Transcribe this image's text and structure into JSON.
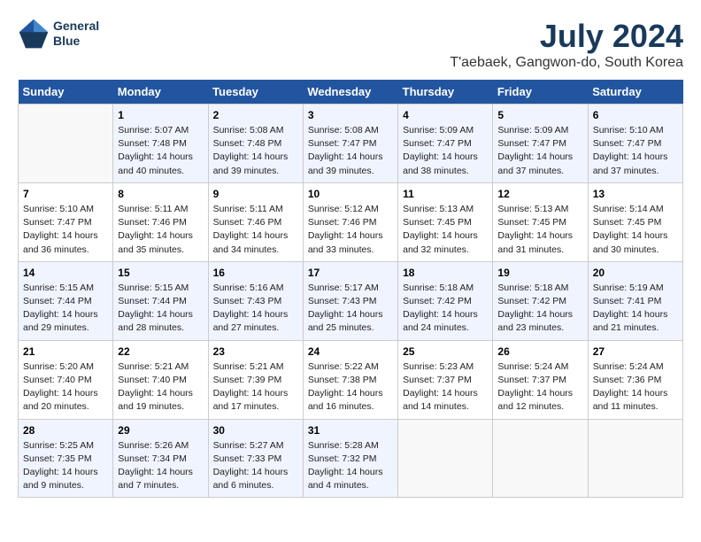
{
  "logo": {
    "line1": "General",
    "line2": "Blue"
  },
  "title": "July 2024",
  "subtitle": "T'aebaek, Gangwon-do, South Korea",
  "days_of_week": [
    "Sunday",
    "Monday",
    "Tuesday",
    "Wednesday",
    "Thursday",
    "Friday",
    "Saturday"
  ],
  "weeks": [
    [
      {
        "day": "",
        "info": ""
      },
      {
        "day": "1",
        "info": "Sunrise: 5:07 AM\nSunset: 7:48 PM\nDaylight: 14 hours\nand 40 minutes."
      },
      {
        "day": "2",
        "info": "Sunrise: 5:08 AM\nSunset: 7:48 PM\nDaylight: 14 hours\nand 39 minutes."
      },
      {
        "day": "3",
        "info": "Sunrise: 5:08 AM\nSunset: 7:47 PM\nDaylight: 14 hours\nand 39 minutes."
      },
      {
        "day": "4",
        "info": "Sunrise: 5:09 AM\nSunset: 7:47 PM\nDaylight: 14 hours\nand 38 minutes."
      },
      {
        "day": "5",
        "info": "Sunrise: 5:09 AM\nSunset: 7:47 PM\nDaylight: 14 hours\nand 37 minutes."
      },
      {
        "day": "6",
        "info": "Sunrise: 5:10 AM\nSunset: 7:47 PM\nDaylight: 14 hours\nand 37 minutes."
      }
    ],
    [
      {
        "day": "7",
        "info": "Sunrise: 5:10 AM\nSunset: 7:47 PM\nDaylight: 14 hours\nand 36 minutes."
      },
      {
        "day": "8",
        "info": "Sunrise: 5:11 AM\nSunset: 7:46 PM\nDaylight: 14 hours\nand 35 minutes."
      },
      {
        "day": "9",
        "info": "Sunrise: 5:11 AM\nSunset: 7:46 PM\nDaylight: 14 hours\nand 34 minutes."
      },
      {
        "day": "10",
        "info": "Sunrise: 5:12 AM\nSunset: 7:46 PM\nDaylight: 14 hours\nand 33 minutes."
      },
      {
        "day": "11",
        "info": "Sunrise: 5:13 AM\nSunset: 7:45 PM\nDaylight: 14 hours\nand 32 minutes."
      },
      {
        "day": "12",
        "info": "Sunrise: 5:13 AM\nSunset: 7:45 PM\nDaylight: 14 hours\nand 31 minutes."
      },
      {
        "day": "13",
        "info": "Sunrise: 5:14 AM\nSunset: 7:45 PM\nDaylight: 14 hours\nand 30 minutes."
      }
    ],
    [
      {
        "day": "14",
        "info": "Sunrise: 5:15 AM\nSunset: 7:44 PM\nDaylight: 14 hours\nand 29 minutes."
      },
      {
        "day": "15",
        "info": "Sunrise: 5:15 AM\nSunset: 7:44 PM\nDaylight: 14 hours\nand 28 minutes."
      },
      {
        "day": "16",
        "info": "Sunrise: 5:16 AM\nSunset: 7:43 PM\nDaylight: 14 hours\nand 27 minutes."
      },
      {
        "day": "17",
        "info": "Sunrise: 5:17 AM\nSunset: 7:43 PM\nDaylight: 14 hours\nand 25 minutes."
      },
      {
        "day": "18",
        "info": "Sunrise: 5:18 AM\nSunset: 7:42 PM\nDaylight: 14 hours\nand 24 minutes."
      },
      {
        "day": "19",
        "info": "Sunrise: 5:18 AM\nSunset: 7:42 PM\nDaylight: 14 hours\nand 23 minutes."
      },
      {
        "day": "20",
        "info": "Sunrise: 5:19 AM\nSunset: 7:41 PM\nDaylight: 14 hours\nand 21 minutes."
      }
    ],
    [
      {
        "day": "21",
        "info": "Sunrise: 5:20 AM\nSunset: 7:40 PM\nDaylight: 14 hours\nand 20 minutes."
      },
      {
        "day": "22",
        "info": "Sunrise: 5:21 AM\nSunset: 7:40 PM\nDaylight: 14 hours\nand 19 minutes."
      },
      {
        "day": "23",
        "info": "Sunrise: 5:21 AM\nSunset: 7:39 PM\nDaylight: 14 hours\nand 17 minutes."
      },
      {
        "day": "24",
        "info": "Sunrise: 5:22 AM\nSunset: 7:38 PM\nDaylight: 14 hours\nand 16 minutes."
      },
      {
        "day": "25",
        "info": "Sunrise: 5:23 AM\nSunset: 7:37 PM\nDaylight: 14 hours\nand 14 minutes."
      },
      {
        "day": "26",
        "info": "Sunrise: 5:24 AM\nSunset: 7:37 PM\nDaylight: 14 hours\nand 12 minutes."
      },
      {
        "day": "27",
        "info": "Sunrise: 5:24 AM\nSunset: 7:36 PM\nDaylight: 14 hours\nand 11 minutes."
      }
    ],
    [
      {
        "day": "28",
        "info": "Sunrise: 5:25 AM\nSunset: 7:35 PM\nDaylight: 14 hours\nand 9 minutes."
      },
      {
        "day": "29",
        "info": "Sunrise: 5:26 AM\nSunset: 7:34 PM\nDaylight: 14 hours\nand 7 minutes."
      },
      {
        "day": "30",
        "info": "Sunrise: 5:27 AM\nSunset: 7:33 PM\nDaylight: 14 hours\nand 6 minutes."
      },
      {
        "day": "31",
        "info": "Sunrise: 5:28 AM\nSunset: 7:32 PM\nDaylight: 14 hours\nand 4 minutes."
      },
      {
        "day": "",
        "info": ""
      },
      {
        "day": "",
        "info": ""
      },
      {
        "day": "",
        "info": ""
      }
    ]
  ]
}
